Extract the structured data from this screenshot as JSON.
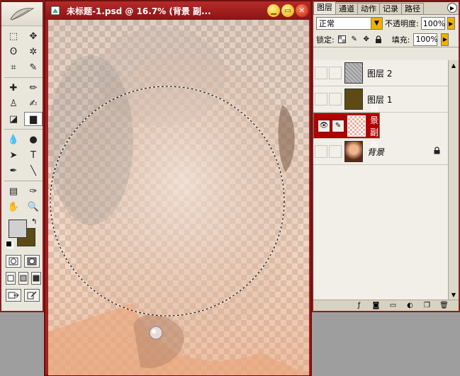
{
  "document": {
    "title": "未标题-1.psd @ 16.7% (背景 副...",
    "minimize_label": "▁",
    "maximize_label": "▭",
    "close_label": "✕"
  },
  "toolbox": {
    "tools": [
      {
        "name": "marquee-tool",
        "glyph": "⬚"
      },
      {
        "name": "move-tool",
        "glyph": "✥"
      },
      {
        "name": "lasso-tool",
        "glyph": "ʘ"
      },
      {
        "name": "magic-wand-tool",
        "glyph": "✲"
      },
      {
        "name": "crop-tool",
        "glyph": "⌗"
      },
      {
        "name": "slice-tool",
        "glyph": "✎"
      },
      {
        "name": "healing-brush-tool",
        "glyph": "✚"
      },
      {
        "name": "brush-tool",
        "glyph": "✏"
      },
      {
        "name": "clone-stamp-tool",
        "glyph": "♙"
      },
      {
        "name": "history-brush-tool",
        "glyph": "✍"
      },
      {
        "name": "eraser-tool",
        "glyph": "◪"
      },
      {
        "name": "gradient-tool",
        "glyph": "▆"
      },
      {
        "name": "blur-tool",
        "glyph": "💧"
      },
      {
        "name": "dodge-tool",
        "glyph": "●"
      },
      {
        "name": "path-selection-tool",
        "glyph": "➤"
      },
      {
        "name": "type-tool",
        "glyph": "T"
      },
      {
        "name": "pen-tool",
        "glyph": "✒"
      },
      {
        "name": "line-tool",
        "glyph": "╲"
      },
      {
        "name": "notes-tool",
        "glyph": "▤"
      },
      {
        "name": "eyedropper-tool",
        "glyph": "✑"
      },
      {
        "name": "hand-tool",
        "glyph": "✋"
      },
      {
        "name": "zoom-tool",
        "glyph": "🔍"
      }
    ],
    "active_tool": "gradient-tool",
    "foreground_color": "#d0d0d0",
    "background_color": "#5c4b12"
  },
  "layers_panel": {
    "tabs": [
      "图层",
      "通道",
      "动作",
      "记录",
      "路径"
    ],
    "active_tab": "图层",
    "blend_mode": "正常",
    "opacity_label": "不透明度:",
    "opacity_value": "100%",
    "lock_label": "锁定:",
    "fill_label": "填充:",
    "fill_value": "100%",
    "layers": [
      {
        "name": "图层 2",
        "visible": false,
        "selected": false,
        "thumb": "gray-noise"
      },
      {
        "name": "图层 1",
        "visible": false,
        "selected": false,
        "thumb": "olive"
      },
      {
        "name": "背景 副本",
        "visible": true,
        "selected": true,
        "thumb": "checker-photo"
      },
      {
        "name": "背景",
        "visible": false,
        "selected": false,
        "thumb": "photo",
        "locked": true,
        "italic": true
      }
    ]
  },
  "colors": {
    "accent": "#b00000",
    "window_frame": "#8a1f1f",
    "panel_bg": "#e9e6dc"
  }
}
